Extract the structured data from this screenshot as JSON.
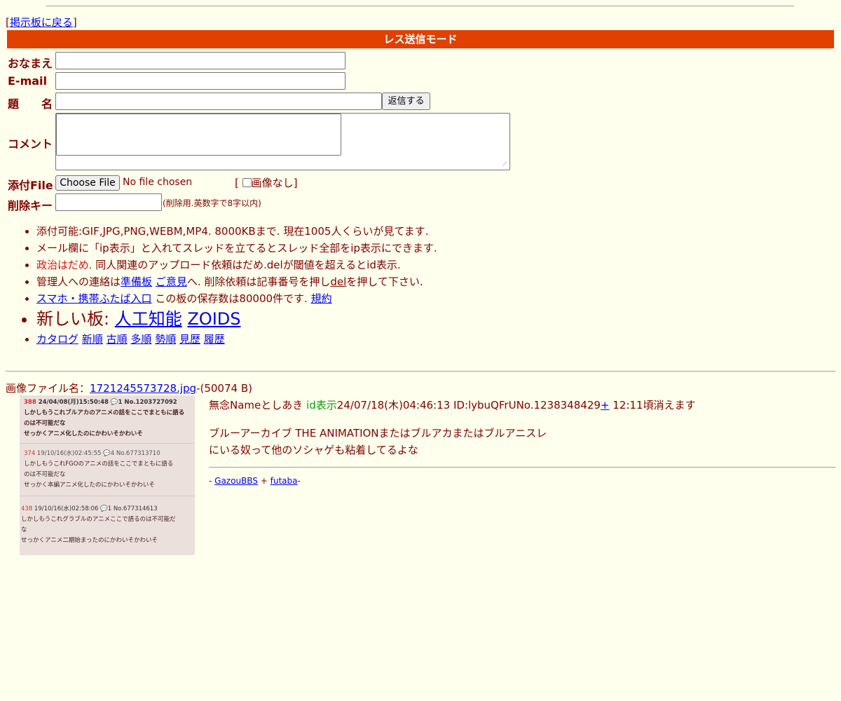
{
  "back": {
    "bracket_open": "[",
    "link": "掲示板に戻る",
    "bracket_close": "]"
  },
  "form": {
    "title": "レス送信モード",
    "name_label": "おなまえ",
    "email_label": "E-mail",
    "subject_label": "題　　名",
    "submit_label": "返信する",
    "comment_label": "コメント",
    "file_label": "添付File",
    "file_button": "Choose File",
    "file_status": "No file chosen",
    "noimage_open": "[",
    "noimage_label": "画像なし",
    "noimage_close": "]",
    "delkey_label": "削除キー",
    "delkey_note": "(削除用.英数字で8字以内)"
  },
  "rules": {
    "r1": "添付可能:GIF,JPG,PNG,WEBM,MP4. 8000KBまで. 現在1005人くらいが見てます.",
    "r2": "メール欄に「ip表示」と入れてスレッドを立てるとスレッド全部をip表示にできます.",
    "r3_red": "政治はだめ.",
    "r3_rest": " 同人関連のアップロード依頼はだめ.delが閾値を超えるとid表示.",
    "r4_pre": "管理人への連絡は",
    "r4_link1": "準備板",
    "r4_link2": "ご意見",
    "r4_mid": "へ. 削除依頼は記事番号を押し",
    "r4_del": "del",
    "r4_post": "を押して下さい.",
    "r5_link": "スマホ・携帯ふたば入口",
    "r5_rest": " この板の保存数は80000件です.",
    "r5_link2": "規約",
    "r6_pre": "新しい板: ",
    "r6_link1": "人工知能",
    "r6_link2": "ZOIDS",
    "r7": [
      "カタログ",
      "新順",
      "古順",
      "多順",
      "勢順",
      "見歴",
      "履歴"
    ]
  },
  "post": {
    "file_prefix": "画像ファイル名：",
    "file_name": "1721245573728.jpg",
    "file_size": "-(50074 B)",
    "name": "無念Nameとしあき",
    "id_display": "id表示",
    "datetime": "24/07/18(木)04:46:13 ID:lybuQFrU",
    "number": "No.1238348429",
    "plus": "+",
    "expire": " 12:11頃消えます",
    "body_line1": "ブルーアーカイブ THE ANIMATIONまたはブルアカまたはブルアニスレ",
    "body_line2": "にいる奴って他のソシャゲも粘着してるよな"
  },
  "thumbnail": {
    "p1_head_num": "388",
    "p1_head": " 24/04/08(月)15:50:48 💬1 No.1203727092",
    "p1_l1": "しかしもうこれブルアカのアニメの話をここでまともに語る",
    "p1_l2": "のは不可能だな",
    "p1_l3": "せっかくアニメ化したのにかわいそかわいそ",
    "p2_head_num": "374",
    "p2_head": " 19/10/16(水)02:45:55 💬4 No.677313710",
    "p2_l1": "しかしもうこれFGOのアニメの話をここでまともに語る",
    "p2_l2": "のは不可能だな",
    "p2_l3": "せっかく本編アニメ化したのにかわいそかわいそ",
    "p3_head_num": "438",
    "p3_head": " 19/10/16(水)02:58:06 💬1 No.677314613",
    "p3_l1": "しかしもうこれグラブルのアニメここで語るのは不可能だ",
    "p3_l2": "な",
    "p3_l3": "せっかくアニメ二期始まったのにかわいそかわいそ"
  },
  "footer": {
    "pre": "- ",
    "link1": "GazouBBS",
    "mid": " + ",
    "link2": "futaba",
    "post": "-"
  }
}
